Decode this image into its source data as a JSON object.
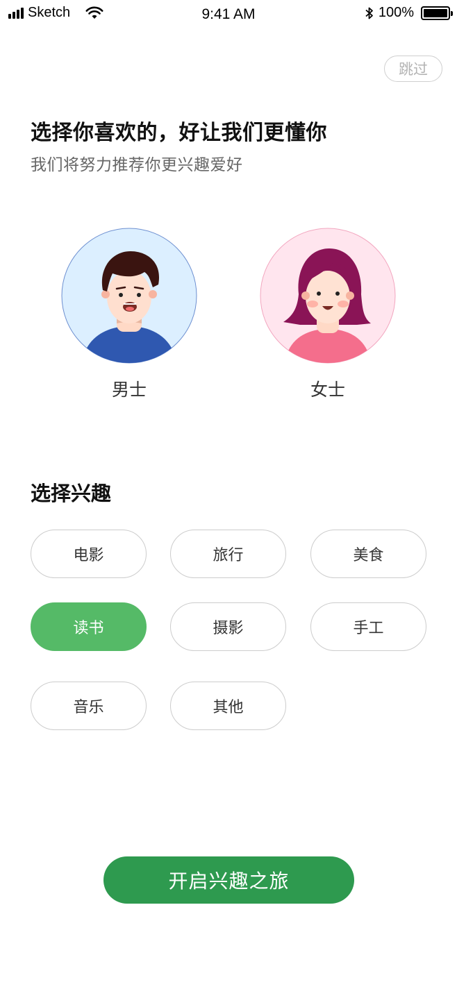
{
  "status_bar": {
    "carrier": "Sketch",
    "time": "9:41 AM",
    "battery": "100%"
  },
  "skip": {
    "label": "跳过"
  },
  "intro": {
    "title": "选择你喜欢的，好让我们更懂你",
    "subtitle": "我们将努力推荐你更兴趣爱好"
  },
  "gender": {
    "options": [
      {
        "label": "男士",
        "icon": "male-avatar-icon"
      },
      {
        "label": "女士",
        "icon": "female-avatar-icon"
      }
    ]
  },
  "interests": {
    "title": "选择兴趣",
    "items": [
      {
        "label": "电影",
        "selected": false
      },
      {
        "label": "旅行",
        "selected": false
      },
      {
        "label": "美食",
        "selected": false
      },
      {
        "label": "读书",
        "selected": true
      },
      {
        "label": "摄影",
        "selected": false
      },
      {
        "label": "手工",
        "selected": false
      },
      {
        "label": "音乐",
        "selected": false
      },
      {
        "label": "其他",
        "selected": false
      }
    ]
  },
  "start": {
    "label": "开启兴趣之旅"
  },
  "colors": {
    "accent": "#2e9a4f",
    "chip_selected": "#55ba67",
    "male_bg": "#dcefff",
    "female_bg": "#ffe5ee"
  }
}
